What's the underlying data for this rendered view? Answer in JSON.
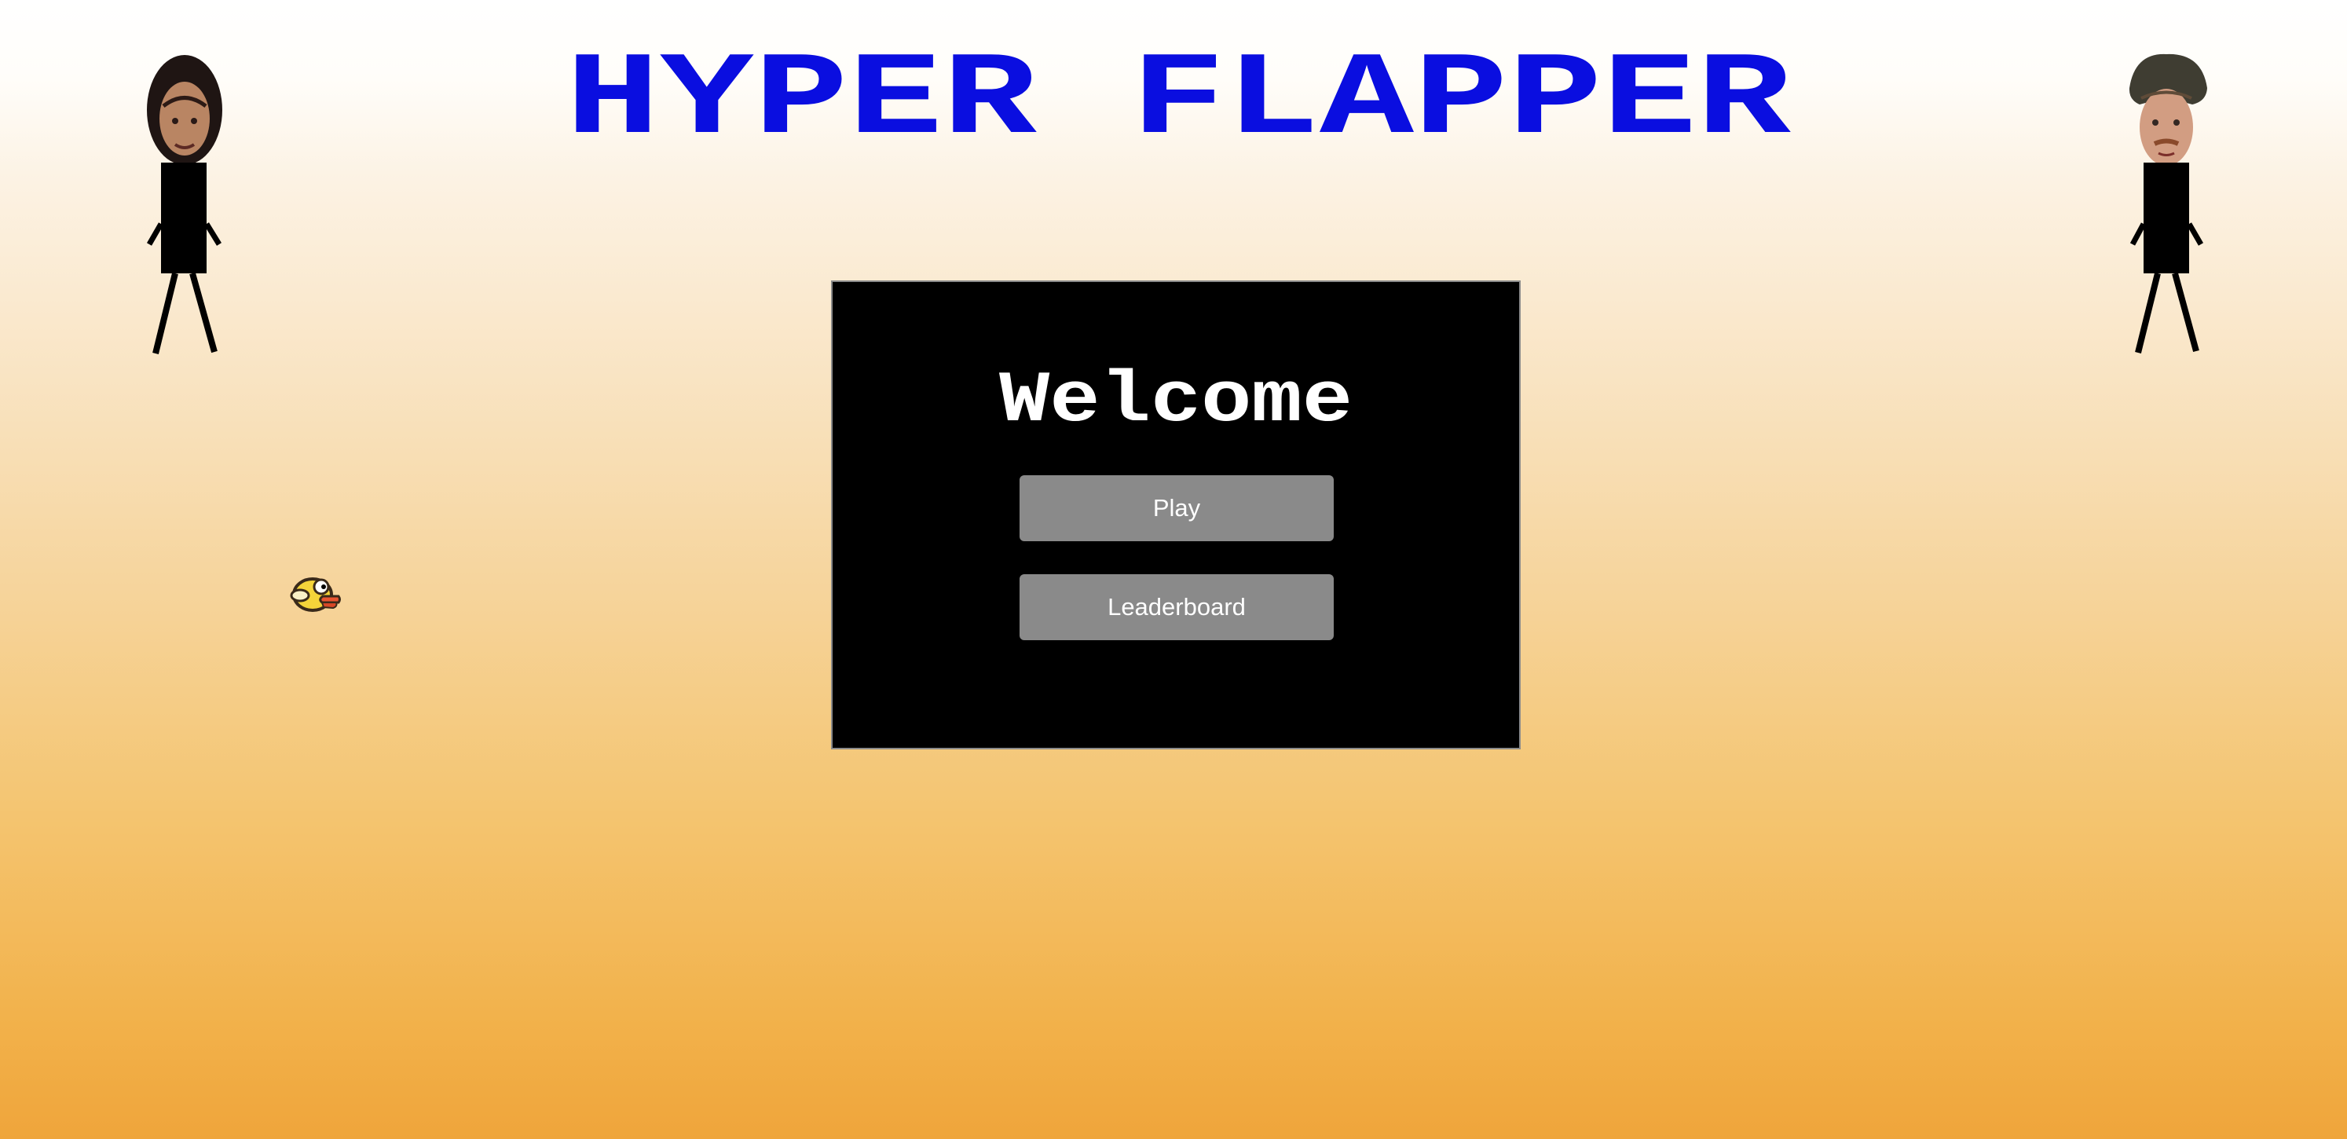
{
  "game": {
    "title": "HYPER FLAPPER",
    "title_color": "#0a0ee0"
  },
  "menu": {
    "heading": "Welcome",
    "play_label": "Play",
    "leaderboard_label": "Leaderboard",
    "panel_color": "#000000",
    "button_color": "#8a8a8a"
  },
  "characters": {
    "left": "player-figure",
    "right": "player-figure"
  },
  "bird_icon": "flappy-bird-icon"
}
